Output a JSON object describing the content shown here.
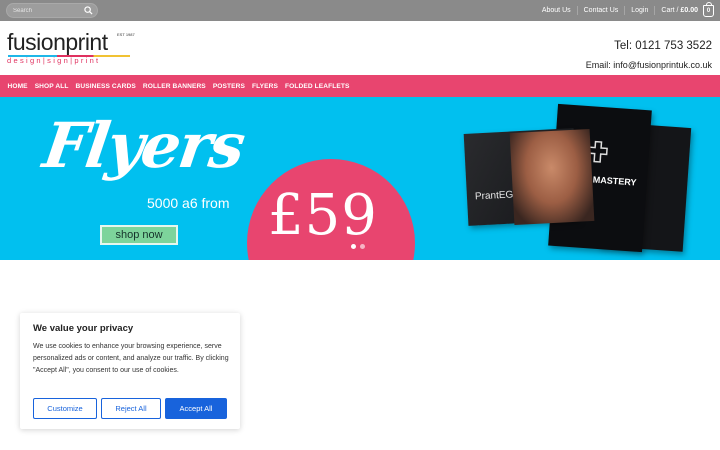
{
  "topbar": {
    "search_placeholder": "Search",
    "links": [
      "About Us",
      "Contact Us",
      "Login"
    ],
    "cart_label": "Cart /",
    "cart_total": "£0.00",
    "cart_count": "0"
  },
  "header": {
    "logo_text": "fusionprint",
    "logo_est": "EST 1987",
    "logo_tagline": "design|sign|print",
    "phone": "Tel: 0121 753 3522",
    "email": "Email: info@fusionprintuk.co.uk"
  },
  "nav": {
    "items": [
      "HOME",
      "SHOP ALL",
      "BUSINESS CARDS",
      "ROLLER BANNERS",
      "POSTERS",
      "FLYERS",
      "FOLDED LEAFLETS"
    ]
  },
  "hero": {
    "title": "Flyers",
    "subtitle": "5000 a6 from",
    "price": "£59",
    "button": "shop now",
    "flyer_a_text": "PrantEG",
    "flyer_b_text": "MASTERY"
  },
  "cookie": {
    "title": "We value your privacy",
    "body": "We use cookies to enhance your browsing experience, serve personalized ads or content, and analyze our traffic. By clicking \"Accept All\", you consent to our use of cookies.",
    "customize": "Customize",
    "reject": "Reject All",
    "accept": "Accept All"
  },
  "colors": {
    "topbar": "#8a8a8a",
    "nav": "#e8456f",
    "hero_bg": "#01c0ef",
    "accent_blue": "#1863dc"
  }
}
